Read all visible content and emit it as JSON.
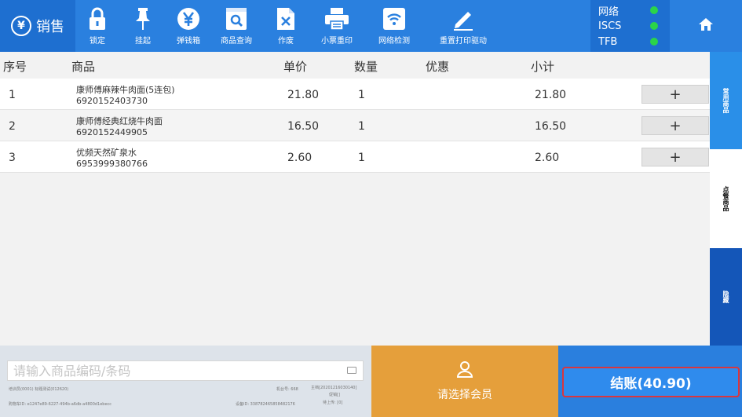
{
  "brand": {
    "title": "销售",
    "icon": "yen-circle-icon"
  },
  "toolbar": [
    {
      "label": "锁定",
      "icon": "lock-icon"
    },
    {
      "label": "挂起",
      "icon": "pin-icon"
    },
    {
      "label": "弹钱箱",
      "icon": "yen-drawer-icon"
    },
    {
      "label": "商品查询",
      "icon": "search-product-icon"
    },
    {
      "label": "作废",
      "icon": "void-document-icon"
    },
    {
      "label": "小票重印",
      "icon": "printer-icon"
    },
    {
      "label": "网络检测",
      "icon": "wifi-icon"
    },
    {
      "label": "重置打印驱动",
      "icon": "pencil-icon"
    }
  ],
  "status": [
    {
      "label": "网络",
      "color": "#2bd44a"
    },
    {
      "label": "ISCS",
      "color": "#2bd44a"
    },
    {
      "label": "TFB",
      "color": "#2bd44a"
    }
  ],
  "table": {
    "headers": {
      "index": "序号",
      "product": "商品",
      "price": "单价",
      "qty": "数量",
      "discount": "优惠",
      "subtotal": "小计"
    },
    "rows": [
      {
        "index": "1",
        "name": "康师傅麻辣牛肉面(5连包)",
        "code": "6920152403730",
        "price": "21.80",
        "qty": "1",
        "discount": "",
        "subtotal": "21.80",
        "action": "+"
      },
      {
        "index": "2",
        "name": "康师傅经典红烧牛肉面",
        "code": "6920152449905",
        "price": "16.50",
        "qty": "1",
        "discount": "",
        "subtotal": "16.50",
        "action": "+"
      },
      {
        "index": "3",
        "name": "优频天然矿泉水",
        "code": "6953999380766",
        "price": "2.60",
        "qty": "1",
        "discount": "",
        "subtotal": "2.60",
        "action": "+"
      }
    ]
  },
  "side_tabs": [
    "常用商品",
    "点餐商品",
    "隐藏"
  ],
  "input": {
    "placeholder": "请输入商品编码/条码",
    "value": ""
  },
  "meta": {
    "trainer": "培训员(0001) 标题测试(012620)",
    "machine": "机台号: 668",
    "version": "主档[20201216030140]",
    "promo": "促销[]",
    "cart_id": "购物车ID: e1247e89-6227-494b-a6db-a4800d1ebecc",
    "device_id": "设备ID: 338782465858482176",
    "pending": "待上传: [0]"
  },
  "member": {
    "label": "请选择会员",
    "icon": "person-icon"
  },
  "checkout": {
    "label": "结账(40.90)",
    "border_color": "#d9363e"
  },
  "colors": {
    "topbar": "#1e6fd0",
    "toolbar": "#2a80df",
    "member": "#e59f3b",
    "checkout": "#2a7fde",
    "tab_active": "#2a8fe8",
    "tab_dark": "#1456b8"
  }
}
